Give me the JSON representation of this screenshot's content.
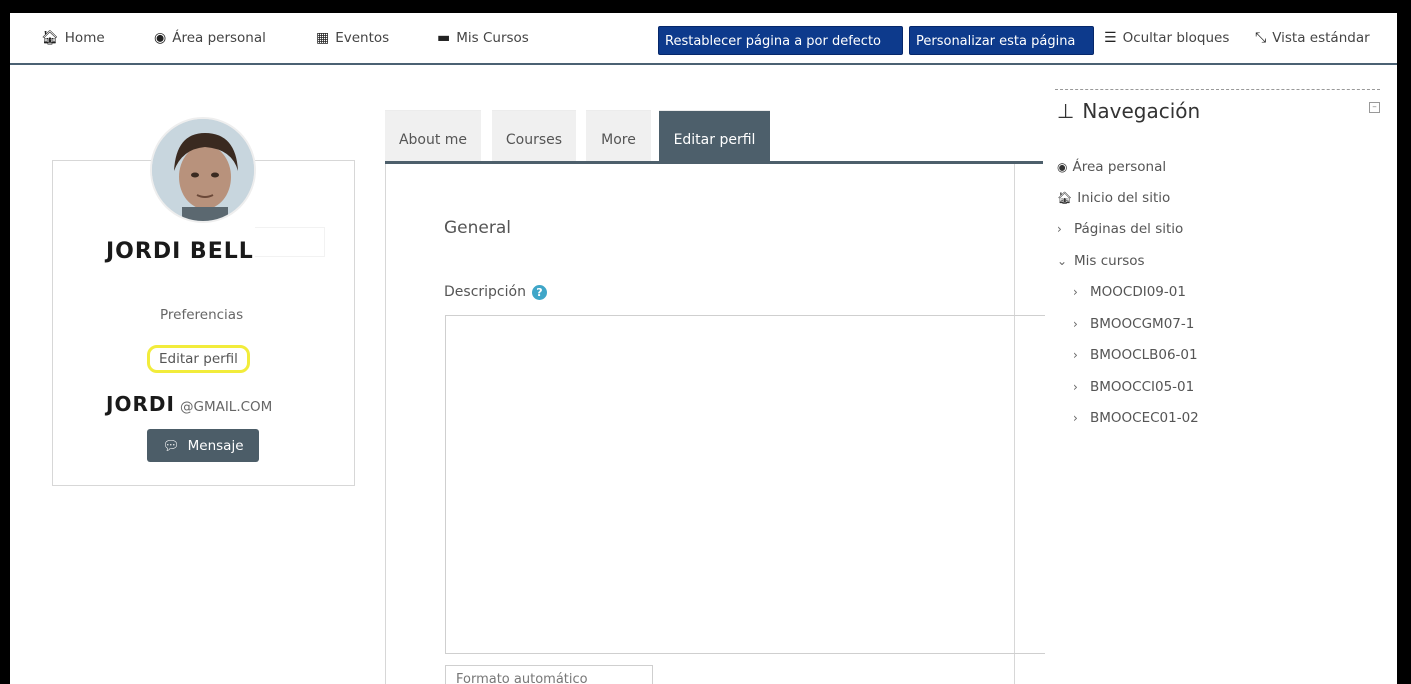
{
  "topbar": {
    "home": "Home",
    "personal_area": "Área personal",
    "events": "Eventos",
    "my_courses": "Mis Cursos",
    "reset_page": "Restablecer página a por defecto",
    "customize_page": "Personalizar esta página",
    "hide_blocks": "Ocultar bloques",
    "standard_view": "Vista estándar"
  },
  "profile": {
    "name": "JORDI BELL",
    "preferences": "Preferencias",
    "edit_profile": "Editar perfil",
    "email_user": "JORDI",
    "email_domain": "@GMAIL.COM",
    "message_button": "Mensaje"
  },
  "tabs": [
    "About me",
    "Courses",
    "More",
    "Editar perfil"
  ],
  "form": {
    "section": "General",
    "description_label": "Descripción",
    "format_select": "Formato automático"
  },
  "navigation": {
    "title": "Navegación",
    "items": {
      "personal_area": "Área personal",
      "site_home": "Inicio del sitio",
      "site_pages": "Páginas del sitio",
      "my_courses": "Mis cursos"
    },
    "courses": [
      "MOOCDI09-01",
      "BMOOCGM07-1",
      "BMOOCLB06-01",
      "BMOOCCI05-01",
      "BMOOCEC01-02"
    ]
  },
  "colors": {
    "primary_button": "#0d3a8c",
    "tab_active": "#4d5f6b",
    "highlight_ring": "#f2ec3b",
    "help_icon": "#3fa6c8"
  }
}
